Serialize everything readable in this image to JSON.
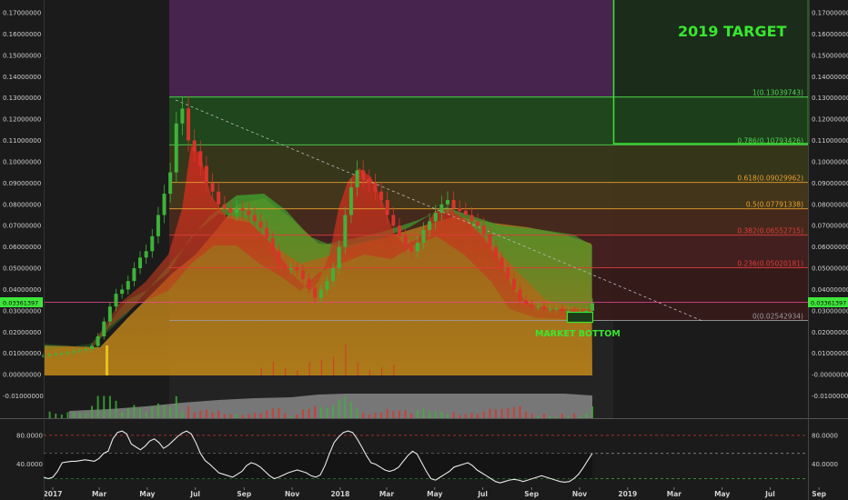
{
  "chart_data": [
    {
      "type": "candlestick",
      "yticks": [
        "0.17000000",
        "0.16000000",
        "0.15000000",
        "0.14000000",
        "0.13000000",
        "0.12000000",
        "0.11000000",
        "0.10000000",
        "0.09000000",
        "0.08000000",
        "0.07000000",
        "0.06000000",
        "0.05000000",
        "0.04000000",
        "0.03000000",
        "0.02000000",
        "0.01000000",
        "0.00000000",
        "-0.01000000"
      ],
      "yticks_right": [
        "0.17000000",
        "0.16000000",
        "0.15000000",
        "0.14000000",
        "0.13000000",
        "0.12000000",
        "0.11000000",
        "0.10000000",
        "0.09000000",
        "0.08000000",
        "0.07000000",
        "0.06000000",
        "0.05000000",
        "0.04000000",
        "0.03000000",
        "0.02000000",
        "0.01000000",
        "-0.00000000",
        "-0.01000000"
      ],
      "ylim": [
        -0.013,
        0.175
      ],
      "xticks": [
        "2017",
        "Mar",
        "May",
        "Jul",
        "Sep",
        "Nov",
        "2018",
        "Mar",
        "May",
        "Jul",
        "Sep",
        "Nov",
        "2019",
        "Mar",
        "May",
        "Jul",
        "Sep"
      ],
      "xtick_dates": [
        "2017-01-01",
        "2017-03-01",
        "2017-05-01",
        "2017-07-01",
        "2017-09-01",
        "2017-11-01",
        "2018-01-01",
        "2018-03-01",
        "2018-05-01",
        "2018-07-01",
        "2018-09-01",
        "2018-11-01",
        "2019-01-01",
        "2019-03-01",
        "2019-05-01",
        "2019-07-01",
        "2019-09-01"
      ],
      "price_close": [
        0.009,
        0.0095,
        0.0098,
        0.01,
        0.0105,
        0.011,
        0.0115,
        0.012,
        0.0135,
        0.018,
        0.025,
        0.032,
        0.038,
        0.04,
        0.044,
        0.05,
        0.055,
        0.058,
        0.065,
        0.075,
        0.085,
        0.095,
        0.118,
        0.125,
        0.11,
        0.105,
        0.098,
        0.09,
        0.086,
        0.08,
        0.078,
        0.076,
        0.078,
        0.077,
        0.075,
        0.072,
        0.069,
        0.064,
        0.058,
        0.052,
        0.05,
        0.05,
        0.049,
        0.045,
        0.041,
        0.036,
        0.04,
        0.044,
        0.05,
        0.06,
        0.075,
        0.088,
        0.096,
        0.092,
        0.09,
        0.086,
        0.082,
        0.075,
        0.07,
        0.065,
        0.06,
        0.058,
        0.062,
        0.068,
        0.072,
        0.076,
        0.08,
        0.082,
        0.078,
        0.077,
        0.075,
        0.072,
        0.07,
        0.066,
        0.06,
        0.055,
        0.05,
        0.045,
        0.04,
        0.035,
        0.033,
        0.032,
        0.032,
        0.031,
        0.031,
        0.031,
        0.03,
        0.03,
        0.029,
        0.029,
        0.03,
        0.0336
      ],
      "current_price": "0.03361397",
      "fib_levels": [
        {
          "ratio": 1,
          "label": "1(0.13039743)",
          "price": 0.13039743,
          "color": "#4fd64f"
        },
        {
          "ratio": 0.786,
          "label": "0.786(0.10793426)",
          "price": 0.10793426,
          "color": "#4fd64f"
        },
        {
          "ratio": 0.618,
          "label": "0.618(0.09029962)",
          "price": 0.09029962,
          "color": "#e8a030"
        },
        {
          "ratio": 0.5,
          "label": "0.5(0.07791338)",
          "price": 0.07791338,
          "color": "#e8a030"
        },
        {
          "ratio": 0.382,
          "label": "0.382(0.06552715)",
          "price": 0.06552715,
          "color": "#e03a3a"
        },
        {
          "ratio": 0.236,
          "label": "0.236(0.05020181)",
          "price": 0.05020181,
          "color": "#e03a3a"
        },
        {
          "ratio": 0,
          "label": "0(0.02542934)",
          "price": 0.02542934,
          "color": "#9a9a9a"
        }
      ],
      "annotations": {
        "target": "2019 TARGET",
        "bottom": "MARKET BOTTOM"
      }
    },
    {
      "type": "line",
      "name": "oscillator",
      "yticks": [
        "80.0000",
        "40.0000"
      ],
      "yticks_right": [
        "80.0000",
        "40.0000"
      ],
      "ylim": [
        8,
        100
      ],
      "bands": [
        80,
        55,
        20
      ],
      "values": [
        22,
        20,
        22,
        30,
        42,
        43,
        44,
        44,
        45,
        46,
        45,
        44,
        48,
        55,
        58,
        75,
        84,
        86,
        82,
        68,
        64,
        60,
        65,
        72,
        75,
        70,
        62,
        66,
        72,
        78,
        83,
        86,
        82,
        70,
        55,
        45,
        40,
        34,
        28,
        26,
        24,
        22,
        26,
        30,
        38,
        42,
        40,
        36,
        30,
        24,
        20,
        22,
        25,
        28,
        30,
        32,
        30,
        28,
        24,
        22,
        25,
        38,
        55,
        70,
        78,
        84,
        86,
        84,
        75,
        64,
        52,
        42,
        40,
        36,
        32,
        30,
        32,
        36,
        44,
        52,
        58,
        54,
        42,
        30,
        20,
        18,
        22,
        26,
        30,
        36,
        38,
        40,
        42,
        38,
        32,
        28,
        24,
        20,
        16,
        14,
        16,
        18,
        19,
        18,
        16,
        18,
        20,
        22,
        24,
        22,
        20,
        18,
        16,
        15,
        16,
        20,
        26,
        35,
        45,
        55
      ]
    }
  ]
}
